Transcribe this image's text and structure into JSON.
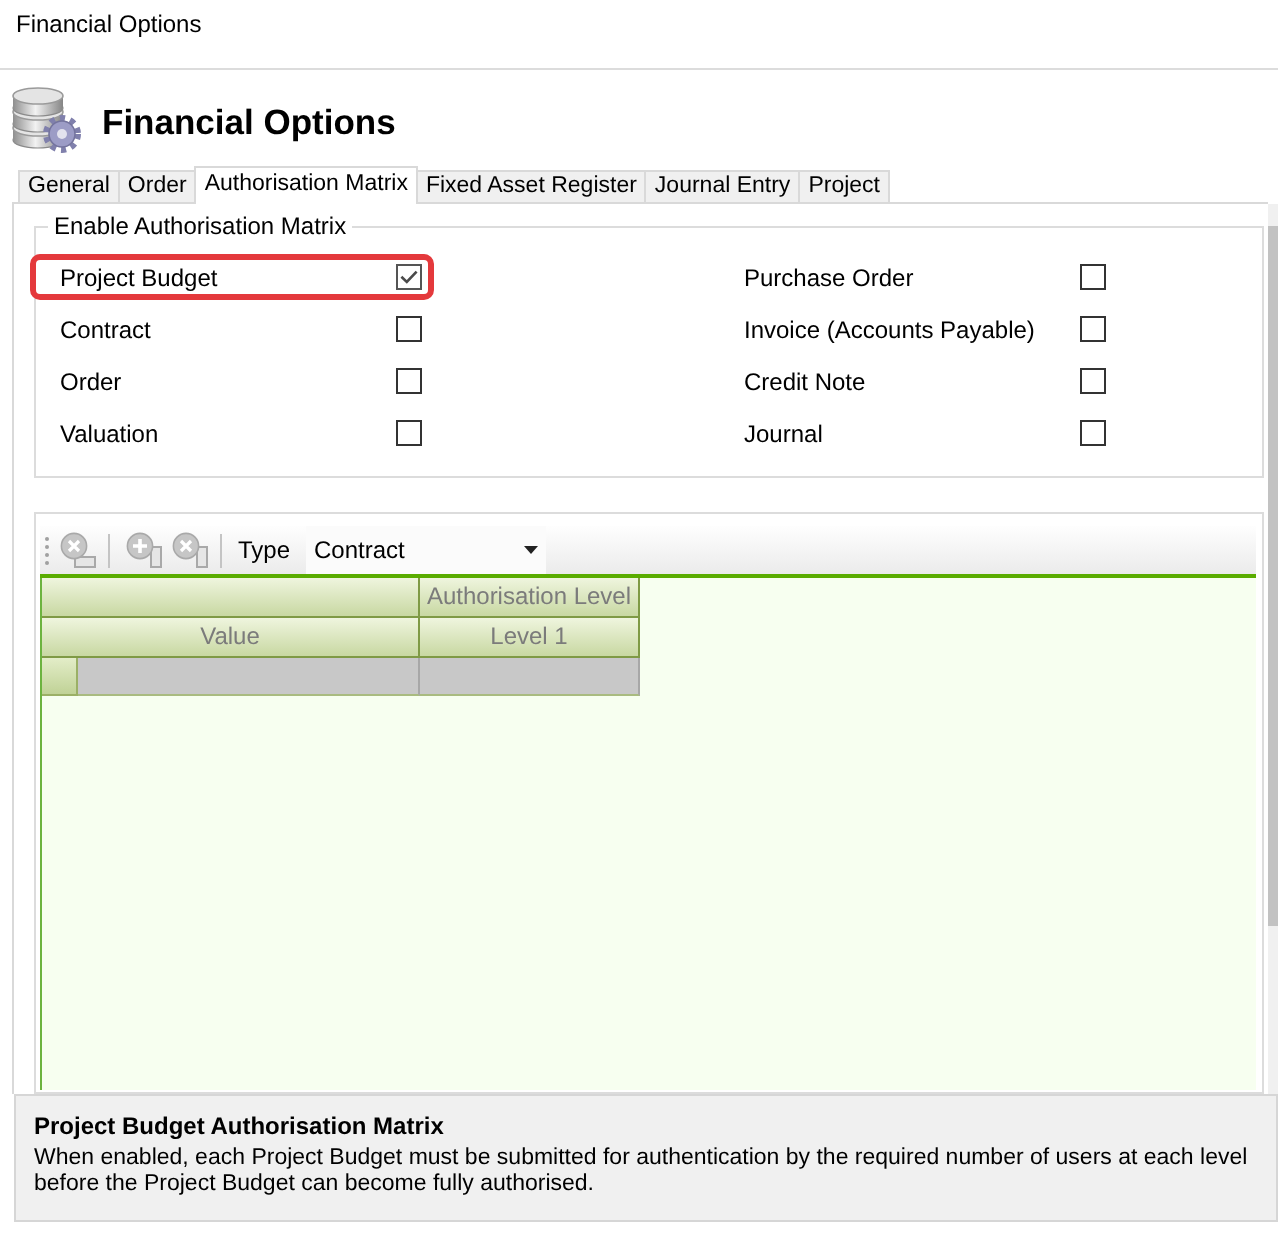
{
  "window": {
    "title": "Financial Options"
  },
  "header": {
    "title": "Financial Options"
  },
  "tabs": [
    {
      "label": "General",
      "selected": false
    },
    {
      "label": "Order",
      "selected": false
    },
    {
      "label": "Authorisation Matrix",
      "selected": true
    },
    {
      "label": "Fixed Asset Register",
      "selected": false
    },
    {
      "label": "Journal Entry",
      "selected": false
    },
    {
      "label": "Project",
      "selected": false
    }
  ],
  "authorisation_group": {
    "title": "Enable Authorisation Matrix",
    "options": [
      {
        "label": "Project Budget",
        "checked": true,
        "highlighted": true
      },
      {
        "label": "Purchase Order",
        "checked": false,
        "highlighted": false
      },
      {
        "label": "Contract",
        "checked": false,
        "highlighted": false
      },
      {
        "label": "Invoice (Accounts Payable)",
        "checked": false,
        "highlighted": false
      },
      {
        "label": "Order",
        "checked": false,
        "highlighted": false
      },
      {
        "label": "Credit Note",
        "checked": false,
        "highlighted": false
      },
      {
        "label": "Valuation",
        "checked": false,
        "highlighted": false
      },
      {
        "label": "Journal",
        "checked": false,
        "highlighted": false
      }
    ]
  },
  "matrix": {
    "toolbar": {
      "buttons": [
        {
          "kind": "row_delete",
          "disabled": true
        },
        {
          "kind": "column_add",
          "disabled": true
        },
        {
          "kind": "column_delete",
          "disabled": true
        }
      ],
      "type_label": "Type",
      "type_value": "Contract"
    },
    "grid": {
      "group_header": "Authorisation Level",
      "columns": [
        "Value",
        "Level 1"
      ],
      "rows": [
        {
          "kind": "blank"
        }
      ]
    }
  },
  "help": {
    "title": "Project Budget Authorisation Matrix",
    "text": "When enabled, each Project Budget must be submitted for authentication by the required number of users at each level before the Project Budget can become fully authorised."
  }
}
